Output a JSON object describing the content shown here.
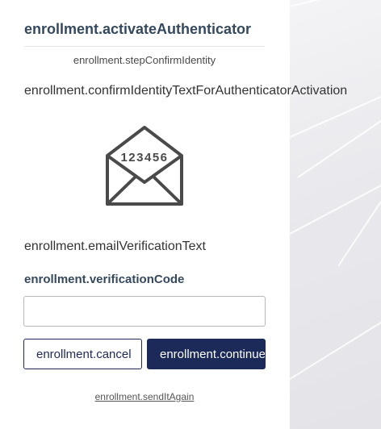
{
  "enrollment": {
    "title": "enrollment.activateAuthenticator",
    "step": "enrollment.stepConfirmIdentity",
    "confirm_text": "enrollment.confirmIdentityTextForAuthenticatorActivation",
    "envelope_code": "123456",
    "email_text": "enrollment.emailVerificationText",
    "code_label": "enrollment.verificationCode",
    "code_value": "",
    "cancel_label": "enrollment.cancel",
    "continue_label": "enrollment.continue",
    "send_again_label": "enrollment.sendItAgain"
  },
  "icons": {
    "envelope": "open-envelope-icon"
  },
  "colors": {
    "title": "#34495e",
    "primary_button": "#1c2a5a",
    "background_panel": "#e9e9ed"
  }
}
